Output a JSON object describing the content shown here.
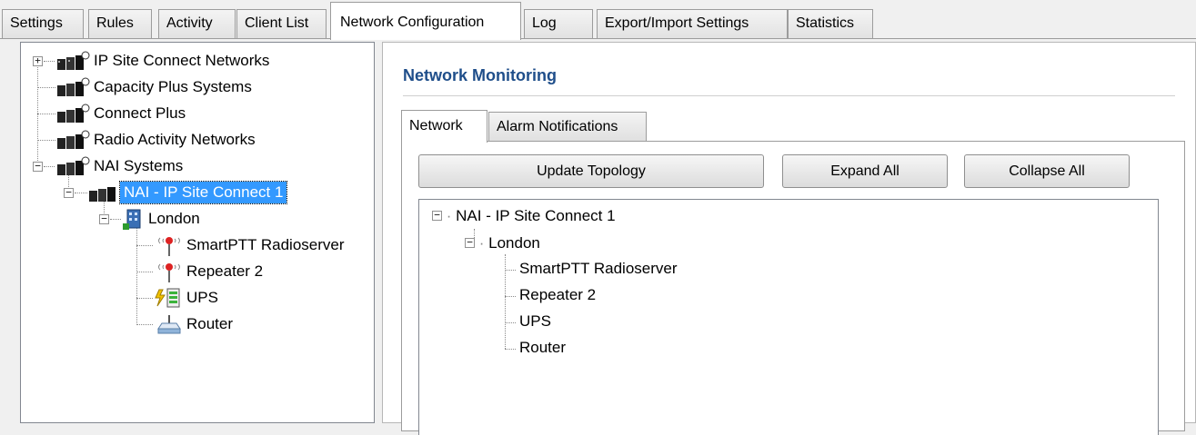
{
  "tabs": {
    "settings": "Settings",
    "rules": "Rules",
    "activity": "Activity",
    "client_list": "Client List",
    "network_configuration": "Network Configuration",
    "log": "Log",
    "export_import": "Export/Import Settings",
    "statistics": "Statistics",
    "active": "Network Configuration"
  },
  "tree": {
    "ip_site_connect_networks": "IP Site Connect Networks",
    "capacity_plus_systems": "Capacity Plus Systems",
    "connect_plus": "Connect Plus",
    "radio_activity_networks": "Radio Activity Networks",
    "nai_systems": "NAI Systems",
    "nai_ip_site_connect_1": "NAI - IP Site Connect 1",
    "london": "London",
    "smartptt_radioserver": "SmartPTT Radioserver",
    "repeater_2": "Repeater 2",
    "ups": "UPS",
    "router": "Router"
  },
  "panel": {
    "title": "Network Monitoring",
    "subtabs": {
      "network": "Network",
      "alarm_notifications": "Alarm Notifications"
    },
    "buttons": {
      "update_topology": "Update Topology",
      "expand_all": "Expand All",
      "collapse_all": "Collapse All"
    },
    "topology": {
      "root": "NAI - IP Site Connect 1",
      "site": "London",
      "devices": [
        "SmartPTT Radioserver",
        "Repeater 2",
        "UPS",
        "Router"
      ]
    }
  },
  "colors": {
    "selection": "#3399ff",
    "title_blue": "#1f4e8a"
  },
  "icons": {
    "network": "network-icon",
    "site": "building-icon",
    "radio": "radio-tower-icon",
    "ups": "battery-icon",
    "router": "router-icon"
  }
}
